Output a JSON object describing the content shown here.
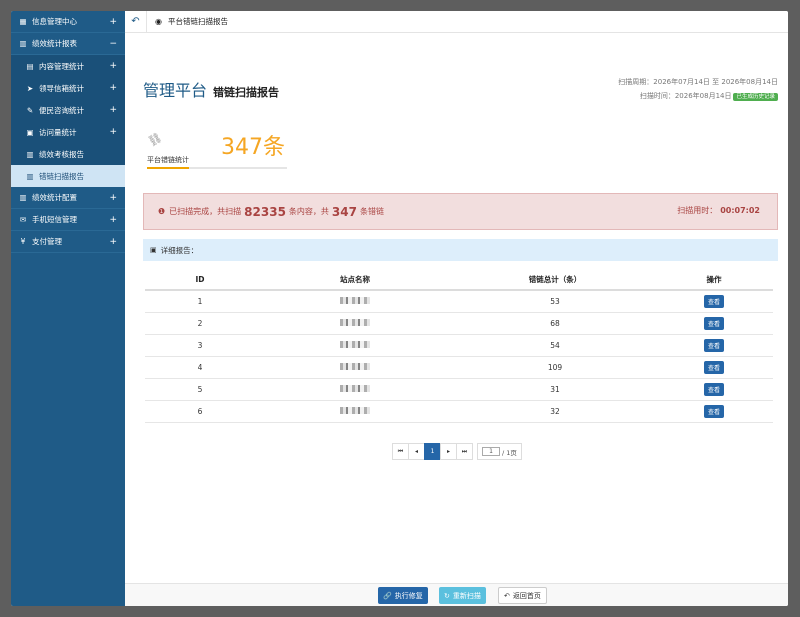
{
  "sidebar": {
    "items": [
      {
        "icon": "grid-icon",
        "glyph": "▦",
        "label": "信息管理中心",
        "toggle": "+",
        "level": "top",
        "active": false
      },
      {
        "icon": "chart-icon",
        "glyph": "▥",
        "label": "绩效统计报表",
        "toggle": "−",
        "level": "top",
        "active": false
      },
      {
        "icon": "doc-icon",
        "glyph": "▤",
        "label": "内容管理统计",
        "toggle": "+",
        "level": "sub",
        "active": false
      },
      {
        "icon": "send-icon",
        "glyph": "➤",
        "label": "领导信箱统计",
        "toggle": "+",
        "level": "sub",
        "active": false
      },
      {
        "icon": "edit-icon",
        "glyph": "✎",
        "label": "便民咨询统计",
        "toggle": "+",
        "level": "sub",
        "active": false
      },
      {
        "icon": "clipboard-icon",
        "glyph": "▣",
        "label": "访问量统计",
        "toggle": "+",
        "level": "sub",
        "active": false
      },
      {
        "icon": "chart-icon",
        "glyph": "▥",
        "label": "绩效考核报告",
        "toggle": "",
        "level": "sub",
        "active": false
      },
      {
        "icon": "chart-icon",
        "glyph": "▥",
        "label": "错链扫描报告",
        "toggle": "",
        "level": "sub",
        "active": true
      },
      {
        "icon": "chart-icon",
        "glyph": "▥",
        "label": "绩效统计配置",
        "toggle": "+",
        "level": "top",
        "active": false
      },
      {
        "icon": "envelope-icon",
        "glyph": "✉",
        "label": "手机短信管理",
        "toggle": "+",
        "level": "top",
        "active": false
      },
      {
        "icon": "yen-icon",
        "glyph": "¥",
        "label": "支付管理",
        "toggle": "+",
        "level": "top",
        "active": false
      }
    ]
  },
  "topbar": {
    "back_glyph": "↶",
    "tab_glyph": "◉",
    "tab_label": "平台错链扫描报告"
  },
  "header": {
    "brand": "管理平台",
    "subtitle": "错链扫描报告",
    "period_label": "扫描周期：",
    "period_value": "2026年07月14日 至 2026年08月14日",
    "time_label": "扫描时间：",
    "time_value": "2026年08月14日",
    "history_badge": "已生成历史记录"
  },
  "stat": {
    "glyph": "⛓",
    "label": "平台错链统计",
    "value": "347条",
    "progress": 0.3
  },
  "alert": {
    "glyph": "❶",
    "prefix": "已扫描完成，共扫描",
    "scanned": "82335",
    "middle": "条内容，共",
    "errors": "347",
    "suffix": "条错链",
    "timer_label": "扫描用时：",
    "timer_value": "00:07:02"
  },
  "detail": {
    "glyph": "▣",
    "label": "详细报告："
  },
  "table": {
    "headers": [
      "ID",
      "站点名称",
      "错链总计（条）",
      "操作"
    ],
    "rows": [
      {
        "id": "1",
        "count": "53",
        "action": "查看"
      },
      {
        "id": "2",
        "count": "68",
        "action": "查看"
      },
      {
        "id": "3",
        "count": "54",
        "action": "查看"
      },
      {
        "id": "4",
        "count": "109",
        "action": "查看"
      },
      {
        "id": "5",
        "count": "31",
        "action": "查看"
      },
      {
        "id": "6",
        "count": "32",
        "action": "查看"
      }
    ]
  },
  "pager": {
    "first": "⏮",
    "prev": "◂",
    "current": "1",
    "next": "▸",
    "last": "⏭",
    "page_input": "1",
    "total": "/ 1页"
  },
  "footer": {
    "fix_glyph": "🔗",
    "fix_label": "执行修复",
    "rescan_glyph": "↻",
    "rescan_label": "重新扫描",
    "home_glyph": "↶",
    "home_label": "返回首页"
  }
}
